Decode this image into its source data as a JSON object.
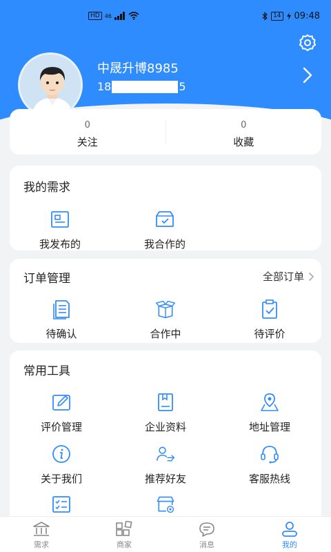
{
  "status_bar": {
    "network": "HD",
    "signal": "46",
    "battery": "14",
    "time": "09:48"
  },
  "profile": {
    "name": "中晟升博8985",
    "phone_prefix": "18",
    "phone_suffix": "5"
  },
  "stats": [
    {
      "value": "0",
      "label": "关注"
    },
    {
      "value": "0",
      "label": "收藏"
    }
  ],
  "my_requirements": {
    "title": "我的需求",
    "items": [
      {
        "label": "我发布的",
        "icon": "document-icon"
      },
      {
        "label": "我合作的",
        "icon": "inbox-check-icon"
      }
    ]
  },
  "orders": {
    "title": "订单管理",
    "all_link": "全部订单",
    "items": [
      {
        "label": "待确认",
        "icon": "file-list-icon"
      },
      {
        "label": "合作中",
        "icon": "box-icon"
      },
      {
        "label": "待评价",
        "icon": "clipboard-check-icon"
      }
    ]
  },
  "tools": {
    "title": "常用工具",
    "items": [
      {
        "label": "评价管理",
        "icon": "edit-icon"
      },
      {
        "label": "企业资料",
        "icon": "company-book-icon"
      },
      {
        "label": "地址管理",
        "icon": "map-pin-icon"
      },
      {
        "label": "关于我们",
        "icon": "info-icon"
      },
      {
        "label": "推荐好友",
        "icon": "share-user-icon"
      },
      {
        "label": "客服热线",
        "icon": "headset-icon"
      },
      {
        "label": "",
        "icon": "checklist-icon"
      },
      {
        "label": "",
        "icon": "store-settings-icon"
      }
    ]
  },
  "tabbar": [
    {
      "label": "需求",
      "icon": "bank-icon",
      "active": false
    },
    {
      "label": "商家",
      "icon": "grid-icon",
      "active": false
    },
    {
      "label": "消息",
      "icon": "chat-icon",
      "active": false
    },
    {
      "label": "我的",
      "icon": "user-icon",
      "active": true
    }
  ],
  "colors": {
    "accent": "#2f8cff",
    "background": "#f2f3f5",
    "card": "#ffffff"
  }
}
